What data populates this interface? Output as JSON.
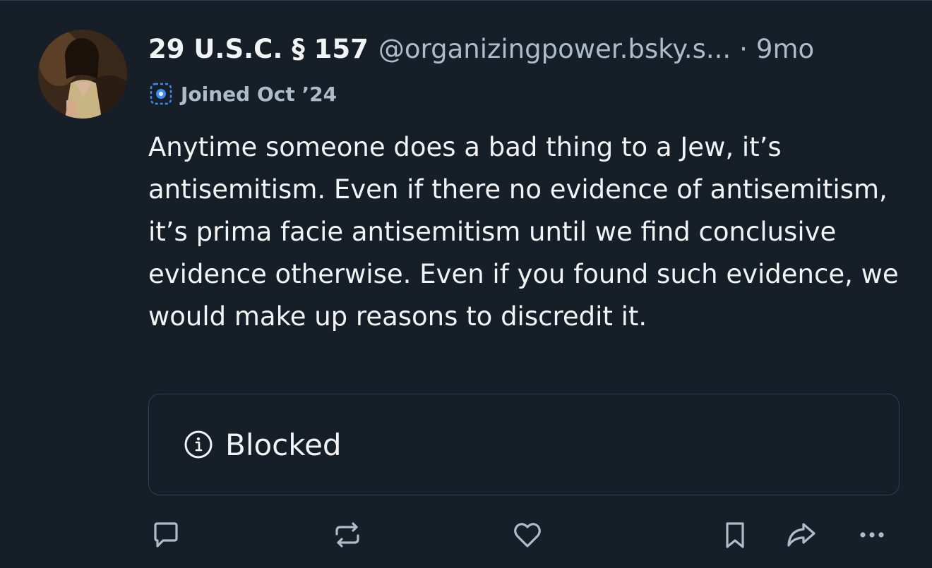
{
  "post": {
    "author": {
      "display_name": "29 U.S.C. § 157",
      "handle": "@organizingpower.bsky.s...",
      "avatar_icon": "profile-photo"
    },
    "separator": "·",
    "timestamp": "9mo",
    "joined": {
      "icon": "new-account-badge-icon",
      "label": "Joined Oct ’24"
    },
    "text": "Anytime someone does a bad thing to a Jew, it’s antisemitism. Even if there no evidence of antisemitism, it’s prima facie antisemitism until we find conclusive evidence otherwise. Even if you found such evidence, we would make up reasons to discredit it.",
    "quote": {
      "icon": "info-icon",
      "label": "Blocked"
    },
    "actions": [
      {
        "name": "reply",
        "icon": "reply-icon"
      },
      {
        "name": "repost",
        "icon": "repost-icon"
      },
      {
        "name": "like",
        "icon": "heart-icon"
      },
      {
        "name": "bookmark",
        "icon": "bookmark-icon"
      },
      {
        "name": "share",
        "icon": "share-icon"
      },
      {
        "name": "more",
        "icon": "more-icon"
      }
    ]
  },
  "colors": {
    "background": "#161e27",
    "text_primary": "#f1f3f5",
    "text_secondary": "#aebbc9",
    "border": "#2e4052",
    "badge_accent": "#3b8cf6"
  }
}
